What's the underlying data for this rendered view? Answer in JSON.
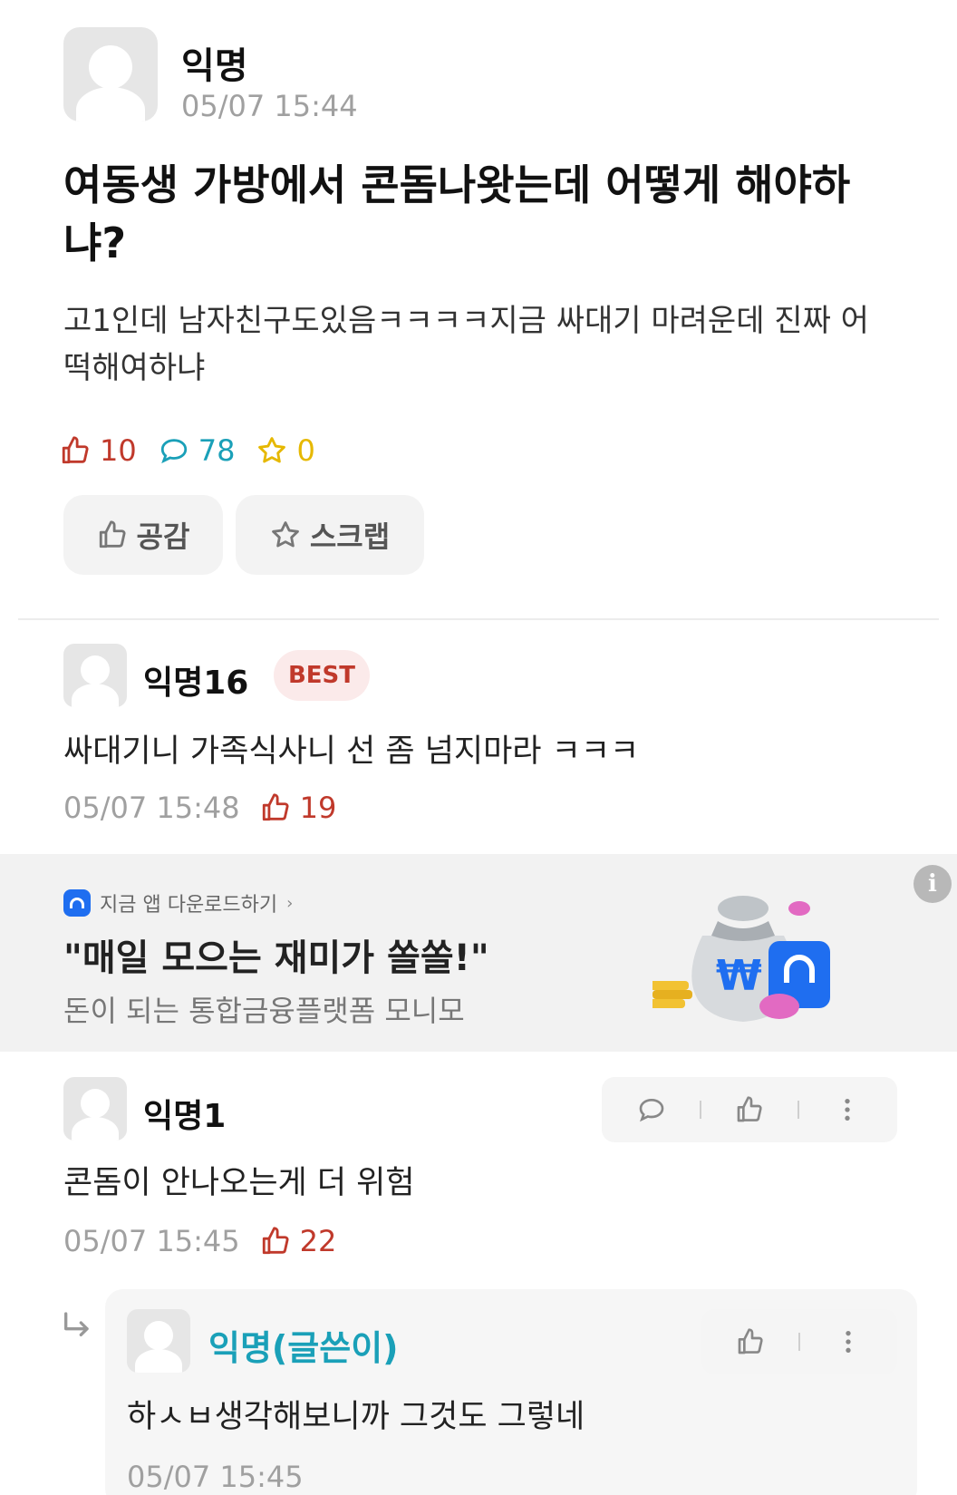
{
  "post": {
    "author": "익명",
    "time": "05/07 15:44",
    "title": "여동생 가방에서 콘돔나왓는데 어떻게 해야하냐?",
    "body": "고1인데 남자친구도있음ㅋㅋㅋㅋ지금 싸대기 마려운데 진짜 어떡해여하냐",
    "likes": "10",
    "comments": "78",
    "scraps": "0",
    "like_button": "공감",
    "scrap_button": "스크랩"
  },
  "best_comment": {
    "author": "익명16",
    "badge": "BEST",
    "text": "싸대기니 가족식사니 선 좀 넘지마라 ㅋㅋㅋ",
    "time": "05/07 15:48",
    "likes": "19"
  },
  "ad": {
    "cta": "지금 앱 다운로드하기",
    "headline": "\"매일 모으는 재미가 쏠쏠!\"",
    "sub": "돈이 되는 통합금융플랫폼 모니모"
  },
  "comment1": {
    "author": "익명1",
    "text": "콘돔이 안나오는게 더 위험",
    "time": "05/07 15:45",
    "likes": "22"
  },
  "reply": {
    "author": "익명(글쓴이)",
    "text": "하ㅅㅂ생각해보니까 그것도 그렇네",
    "time": "05/07 15:45"
  },
  "colors": {
    "like_red": "#c0392b",
    "comment_teal": "#1aa0b8",
    "star_yellow": "#e6b800",
    "writer_teal": "#1aa0b8",
    "best_bg": "#fbeaea",
    "best_text": "#c0392b"
  }
}
